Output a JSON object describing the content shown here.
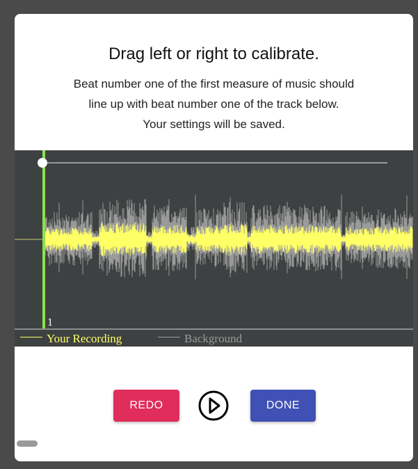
{
  "dialog": {
    "title": "Drag left or right to calibrate.",
    "description_lines": [
      "Beat number one of the first measure of music should",
      "line up with beat number one of the track below.",
      "Your settings will be saved."
    ]
  },
  "waveform": {
    "beat_marker_label": "1",
    "legend": {
      "recording_label": "Your Recording",
      "background_label": "Background"
    },
    "colors": {
      "recording": "#ffff66",
      "background": "#9a9a9a",
      "beat_line": "#8be04e",
      "panel": "#3e4142"
    },
    "offset_slider_value": 0
  },
  "actions": {
    "redo_label": "REDO",
    "done_label": "DONE",
    "play_icon": "play-circle-icon"
  },
  "colors": {
    "outer_background": "#4a4a4a",
    "redo_button": "#e02d5c",
    "done_button": "#3f51b5"
  }
}
